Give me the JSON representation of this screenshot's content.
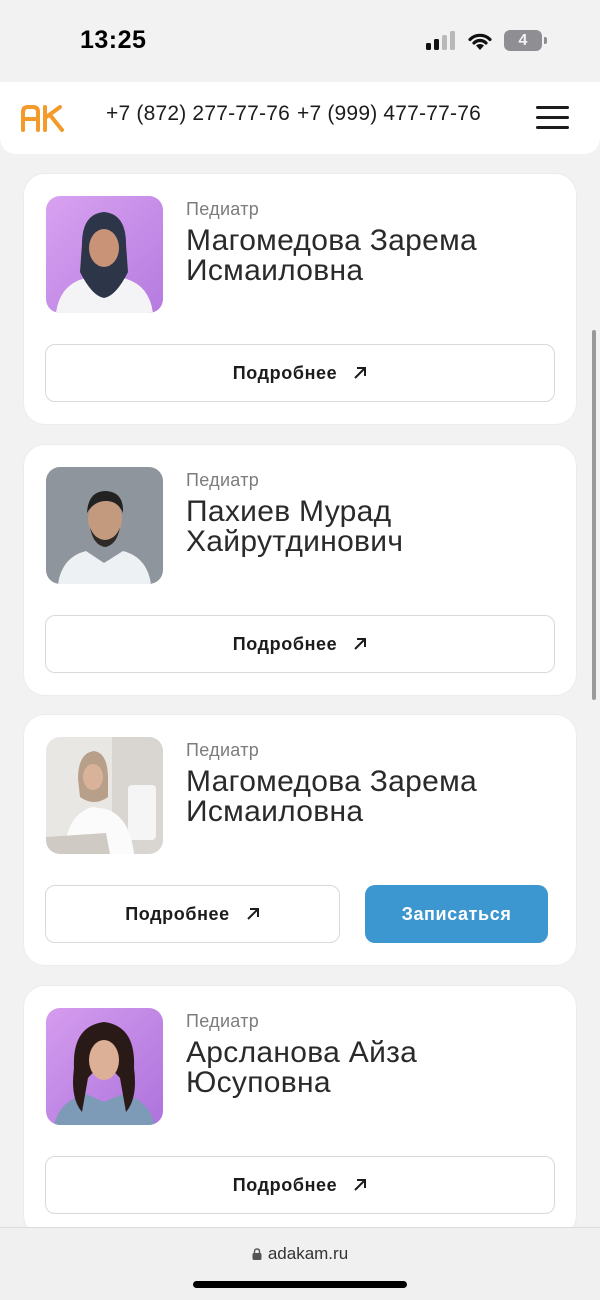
{
  "status_bar": {
    "time": "13:25",
    "battery": "4",
    "signal_icon": "cellular-signal-icon",
    "wifi_icon": "wifi-icon"
  },
  "header": {
    "logo_text": "АК",
    "phones": [
      "+7 (872) 277-77-76",
      "+7 (999) 477-77-76"
    ],
    "menu_icon": "hamburger-menu-icon",
    "accent_color": "#f39a2b"
  },
  "doctors": [
    {
      "specialty": "Педиатр",
      "name": "Магомедова Зарема Исмаиловна",
      "more_label": "Подробнее"
    },
    {
      "specialty": "Педиатр",
      "name": "Пахиев Мурад Хайрутдинович",
      "more_label": "Подробнее"
    },
    {
      "specialty": "Педиатр",
      "name": "Магомедова Зарема Исмаиловна",
      "more_label": "Подробнее",
      "book_label": "Записаться"
    },
    {
      "specialty": "Педиатр",
      "name": "Арсланова Айза Юсуповна",
      "more_label": "Подробнее"
    }
  ],
  "browser": {
    "url": "adakam.ru"
  },
  "colors": {
    "primary_button": "#3c96d0",
    "card_bg": "#ffffff",
    "page_bg": "#f2f2f2"
  }
}
